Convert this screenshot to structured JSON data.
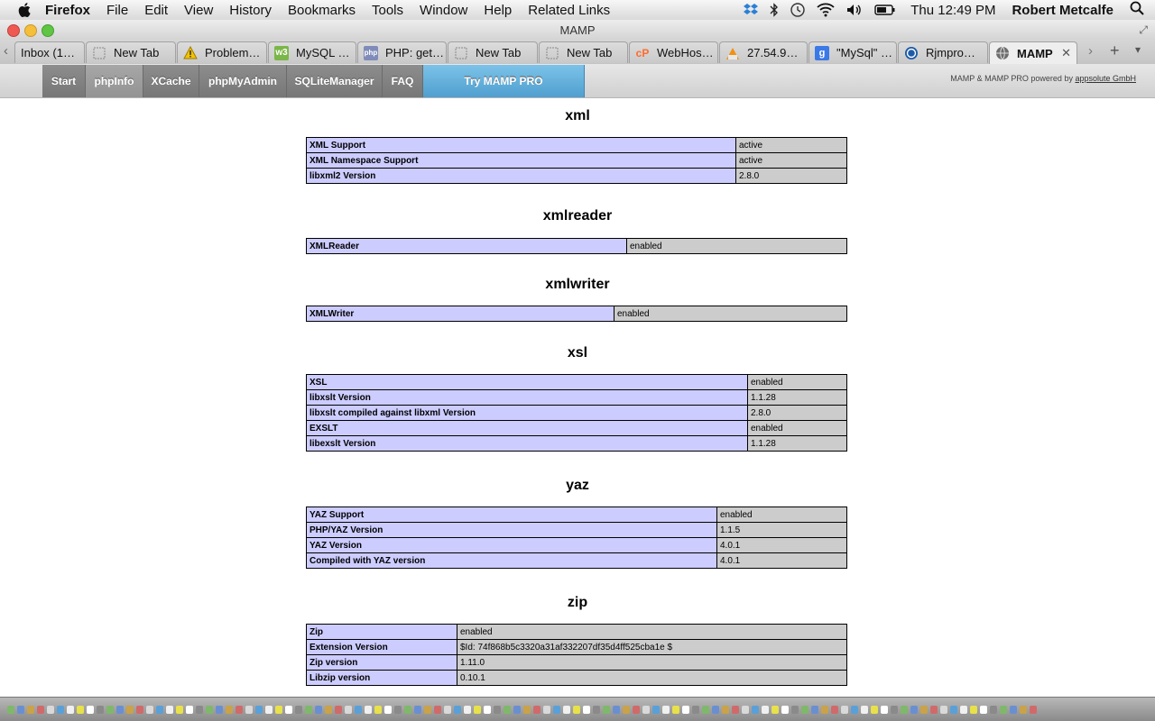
{
  "menubar": {
    "app": "Firefox",
    "items": [
      "File",
      "Edit",
      "View",
      "History",
      "Bookmarks",
      "Tools",
      "Window",
      "Help",
      "Related Links"
    ],
    "clock": "Thu 12:49 PM",
    "user": "Robert Metcalfe"
  },
  "window": {
    "title": "MAMP"
  },
  "tabs": [
    {
      "label": "Inbox (1…"
    },
    {
      "label": "New Tab"
    },
    {
      "label": "Problem…"
    },
    {
      "label": "MySQL …"
    },
    {
      "label": "PHP: get…"
    },
    {
      "label": "New Tab"
    },
    {
      "label": "New Tab"
    },
    {
      "label": "WebHos…"
    },
    {
      "label": "27.54.9…"
    },
    {
      "label": "\"MySql\" …"
    },
    {
      "label": "Rjmpro…"
    },
    {
      "label": "MAMP"
    }
  ],
  "nav": {
    "items": [
      "Start",
      "phpInfo",
      "XCache",
      "phpMyAdmin",
      "SQLiteManager",
      "FAQ",
      "Try MAMP PRO"
    ],
    "powered_prefix": "MAMP & MAMP PRO powered by ",
    "powered_link": "appsolute GmbH"
  },
  "sections": {
    "xml": {
      "title": "xml",
      "rows": [
        [
          "XML Support",
          "active"
        ],
        [
          "XML Namespace Support",
          "active"
        ],
        [
          "libxml2 Version",
          "2.8.0"
        ]
      ]
    },
    "xmlreader": {
      "title": "xmlreader",
      "rows": [
        [
          "XMLReader",
          "enabled"
        ]
      ]
    },
    "xmlwriter": {
      "title": "xmlwriter",
      "rows": [
        [
          "XMLWriter",
          "enabled"
        ]
      ]
    },
    "xsl": {
      "title": "xsl",
      "rows": [
        [
          "XSL",
          "enabled"
        ],
        [
          "libxslt Version",
          "1.1.28"
        ],
        [
          "libxslt compiled against libxml Version",
          "2.8.0"
        ],
        [
          "EXSLT",
          "enabled"
        ],
        [
          "libexslt Version",
          "1.1.28"
        ]
      ]
    },
    "yaz": {
      "title": "yaz",
      "rows": [
        [
          "YAZ Support",
          "enabled"
        ],
        [
          "PHP/YAZ Version",
          "1.1.5"
        ],
        [
          "YAZ Version",
          "4.0.1"
        ],
        [
          "Compiled with YAZ version",
          "4.0.1"
        ]
      ]
    },
    "zip": {
      "title": "zip",
      "rows": [
        [
          "Zip",
          "enabled"
        ],
        [
          "Extension Version",
          "$Id: 74f868b5c3320a31af332207df35d4ff525cba1e $"
        ],
        [
          "Zip version",
          "1.11.0"
        ],
        [
          "Libzip version",
          "0.10.1"
        ]
      ]
    }
  },
  "colors": {
    "label_cell": "#ccccff",
    "value_cell": "#cccccc",
    "pro_button": "#5fa9d6"
  }
}
